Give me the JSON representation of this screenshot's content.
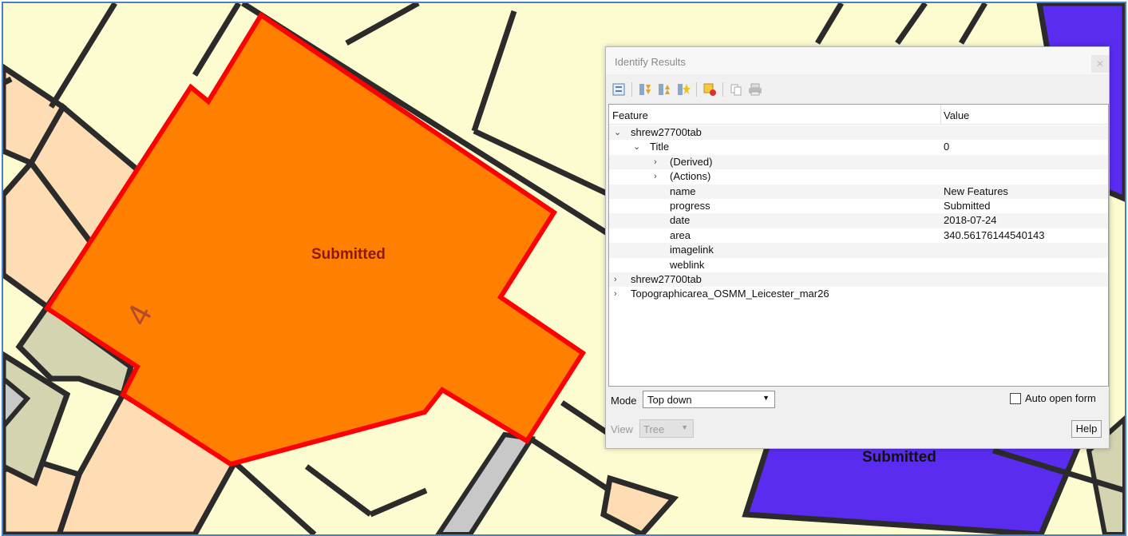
{
  "map": {
    "colors": {
      "background": "#fdfbd0",
      "parcel_selected": "#ff8000",
      "parcel_selected_outline": "#ff0000",
      "parcel_submitted": "#5a2cf0",
      "building": "#fedcb4",
      "road": "#d4d4b0",
      "path": "#c8c8c8",
      "lines": "#2b2b2b"
    },
    "labels": {
      "selected_parcel": "Submitted",
      "selected_parcel_number": "4",
      "other_parcel": "Submitted"
    }
  },
  "dialog": {
    "title": "Identify Results",
    "close_icon": "close-icon",
    "toolbar": {
      "icons": [
        "expand-tree-icon",
        "expand-all-icon",
        "collapse-all-icon",
        "expand-new-results-icon",
        "clear-results-icon",
        "copy-feature-icon",
        "print-icon"
      ]
    },
    "tree": {
      "headers": {
        "feature": "Feature",
        "value": "Value"
      },
      "rows": [
        {
          "arrow": "⌄",
          "label": "shrew27700tab",
          "value": ""
        },
        {
          "arrow": "⌄",
          "label": "Title",
          "value": "0"
        },
        {
          "arrow": "›",
          "label": "(Derived)",
          "value": ""
        },
        {
          "arrow": "›",
          "label": "(Actions)",
          "value": ""
        },
        {
          "arrow": "",
          "label": "name",
          "value": "New Features"
        },
        {
          "arrow": "",
          "label": "progress",
          "value": "Submitted"
        },
        {
          "arrow": "",
          "label": "date",
          "value": "2018-07-24"
        },
        {
          "arrow": "",
          "label": "area",
          "value": "340.56176144540143"
        },
        {
          "arrow": "",
          "label": "imagelink",
          "value": ""
        },
        {
          "arrow": "",
          "label": "weblink",
          "value": ""
        },
        {
          "arrow": "›",
          "label": "shrew27700tab",
          "value": ""
        },
        {
          "arrow": "›",
          "label": "Topographicarea_OSMM_Leicester_mar26",
          "value": ""
        }
      ]
    },
    "mode_label": "Mode",
    "mode_value": "Top down",
    "auto_open_label": "Auto open form",
    "view_label": "View",
    "view_value": "Tree",
    "help_label": "Help"
  }
}
